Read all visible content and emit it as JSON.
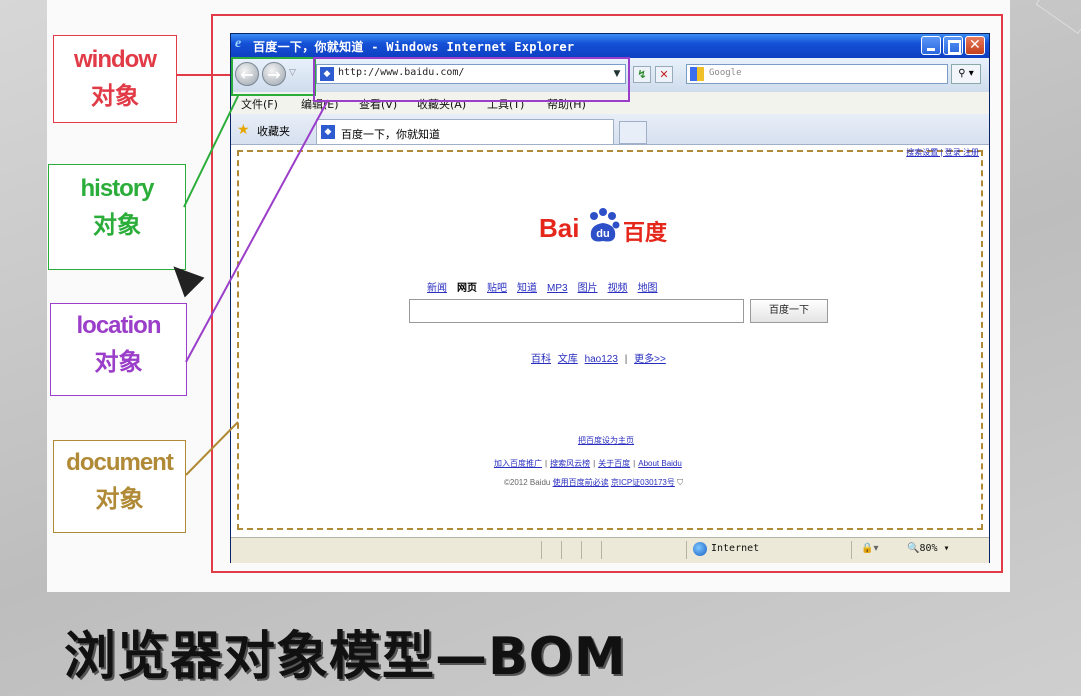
{
  "slide": {
    "title": "浏览器对象模型—BOM"
  },
  "callouts": {
    "window": {
      "en": "window",
      "zh": "对象",
      "color": "#e13b47"
    },
    "history": {
      "en": "history",
      "zh": "对象",
      "color": "#2bad3a"
    },
    "location": {
      "en": "location",
      "zh": "对象",
      "color": "#9b3ec9"
    },
    "document": {
      "en": "document",
      "zh": "对象",
      "color": "#b08a36"
    }
  },
  "browser": {
    "title": "百度一下，你就知道 - Windows Internet Explorer",
    "address_url": "http://www.baidu.com/",
    "search_placeholder": "Google",
    "menu": [
      "文件(F)",
      "编辑(E)",
      "查看(V)",
      "收藏夹(A)",
      "工具(T)",
      "帮助(H)"
    ],
    "favorites_label": "收藏夹",
    "tab_label": "百度一下，你就知道",
    "status_zone": "Internet",
    "zoom": "80%"
  },
  "page": {
    "top_links": "搜索设置 | 登录 注册",
    "logo_text_left": "Bai",
    "logo_paw_text": "du",
    "logo_text_right": "百度",
    "nav_links": [
      "新闻",
      "网页",
      "贴吧",
      "知道",
      "MP3",
      "图片",
      "视频",
      "地图"
    ],
    "search_button": "百度一下",
    "more_links": [
      "百科",
      "文库",
      "hao123",
      "更多>>"
    ],
    "footer_line1": "把百度设为主页",
    "footer_links": [
      "加入百度推广",
      "搜索风云榜",
      "关于百度",
      "About Baidu"
    ],
    "copyright_prefix": "©2012 Baidu",
    "copyright_links": [
      "使用百度前必读",
      "京ICP证030173号"
    ]
  }
}
